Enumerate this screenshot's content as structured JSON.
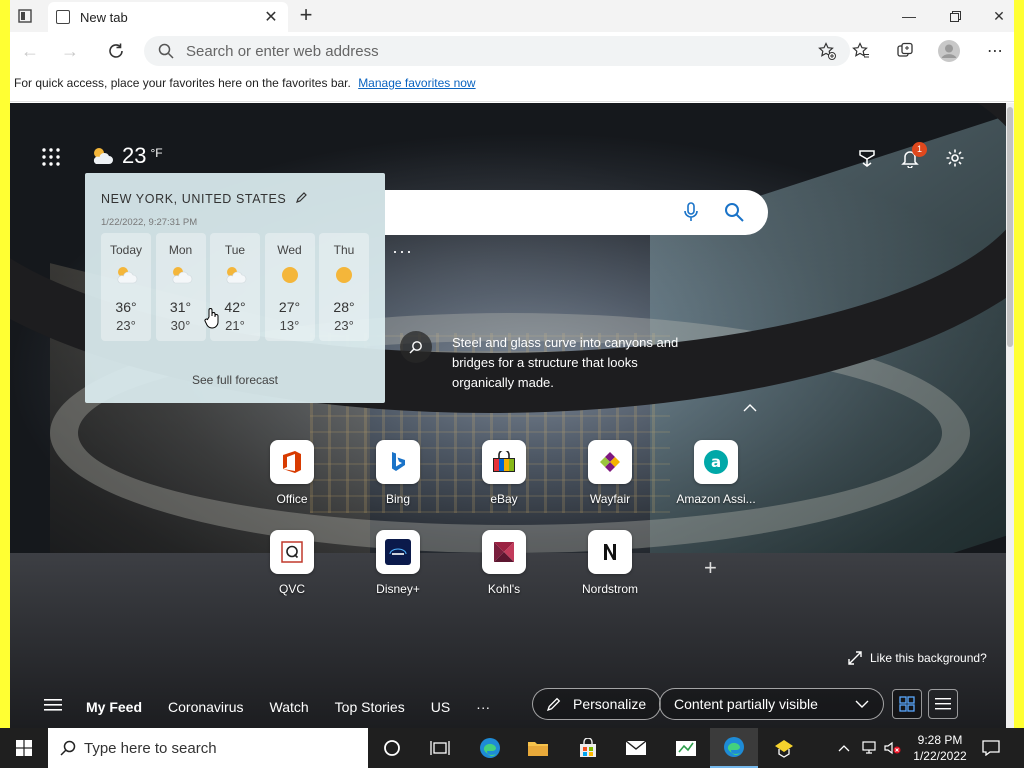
{
  "browser": {
    "tab_title": "New tab",
    "address_placeholder": "Search or enter web address",
    "favbar_text": "For quick access, place your favorites here on the favorites bar.",
    "favbar_link": "Manage favorites now"
  },
  "weather": {
    "current_temp": "23",
    "unit": "°F",
    "location": "NEW YORK, UNITED STATES",
    "timestamp": "1/22/2022, 9:27:31 PM",
    "forecast_link": "See full forecast",
    "days": [
      {
        "name": "Today",
        "hi": "36°",
        "lo": "23°",
        "icon": "partly-cloudy"
      },
      {
        "name": "Mon",
        "hi": "31°",
        "lo": "30°",
        "icon": "partly-cloudy"
      },
      {
        "name": "Tue",
        "hi": "42°",
        "lo": "21°",
        "icon": "partly-cloudy"
      },
      {
        "name": "Wed",
        "hi": "27°",
        "lo": "13°",
        "icon": "sunny"
      },
      {
        "name": "Thu",
        "hi": "28°",
        "lo": "23°",
        "icon": "sunny"
      }
    ]
  },
  "notifications": {
    "count": "1"
  },
  "hero": {
    "caption": "Steel and glass curve into canyons and bridges for a structure that looks organically made.",
    "like_background": "Like this background?"
  },
  "quick_links": [
    {
      "label": "Office"
    },
    {
      "label": "Bing"
    },
    {
      "label": "eBay"
    },
    {
      "label": "Wayfair"
    },
    {
      "label": "Amazon Assi..."
    },
    {
      "label": "QVC"
    },
    {
      "label": "Disney+"
    },
    {
      "label": "Kohl's"
    },
    {
      "label": "Nordstrom"
    }
  ],
  "feed": {
    "items": [
      "My Feed",
      "Coronavirus",
      "Watch",
      "Top Stories",
      "US"
    ],
    "personalize": "Personalize",
    "content_visibility": "Content partially visible"
  },
  "taskbar": {
    "search_placeholder": "Type here to search",
    "time": "9:28 PM",
    "date": "1/22/2022"
  },
  "colors": {
    "accent": "#0b64c0",
    "badge": "#e0481d",
    "frame": "#ffff33"
  }
}
